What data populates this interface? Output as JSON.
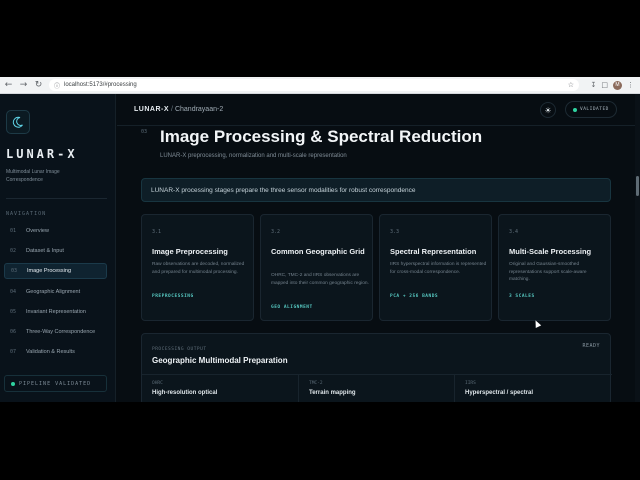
{
  "browser": {
    "url": "localhost:5173/#processing",
    "profile_initial": "M"
  },
  "sidebar": {
    "brand": "LUNAR-X",
    "subtitle": "Multimodal Lunar Image Correspondence",
    "nav_title": "NAVIGATION",
    "items": [
      {
        "num": "01",
        "label": "Overview"
      },
      {
        "num": "02",
        "label": "Dataset & Input"
      },
      {
        "num": "03",
        "label": "Image Processing"
      },
      {
        "num": "04",
        "label": "Geographic Alignment"
      },
      {
        "num": "05",
        "label": "Invariant Representation"
      },
      {
        "num": "06",
        "label": "Three-Way Correspondence"
      },
      {
        "num": "07",
        "label": "Validation & Results"
      }
    ],
    "active_index": 2,
    "status": "PIPELINE VALIDATED"
  },
  "topbar": {
    "app": "LUNAR-X",
    "separator": "/",
    "page": "Chandrayaan-2",
    "validated": "VALIDATED"
  },
  "section": {
    "num": "03",
    "title": "Image Processing & Spectral Reduction",
    "subtitle": "LUNAR-X preprocessing, normalization and multi-scale representation",
    "banner": "LUNAR-X processing stages prepare the three sensor modalities for robust correspondence"
  },
  "cards": [
    {
      "num": "3.1",
      "title": "Image Preprocessing",
      "desc": "Raw observations are decoded, normalized and prepared for multimodal processing.",
      "tag": "PREPROCESSING"
    },
    {
      "num": "3.2",
      "title": "Common Geographic Grid",
      "desc": "OHRC, TMC-2 and IIRS observations are mapped into their common geographic region.",
      "tag": "GEO ALIGNMENT"
    },
    {
      "num": "3.3",
      "title": "Spectral Representation",
      "desc": "IIRS hyperspectral information is represented for cross-modal correspondence.",
      "tag": "PCA + 256 BANDS"
    },
    {
      "num": "3.4",
      "title": "Multi-Scale Processing",
      "desc": "Original and Gaussian-smoothed representations support scale-aware matching.",
      "tag": "3 SCALES"
    }
  ],
  "panel": {
    "label": "PROCESSING OUTPUT",
    "title": "Geographic Multimodal Preparation",
    "status": "READY",
    "columns": [
      {
        "key": "OHRC",
        "value": "High-resolution optical"
      },
      {
        "key": "TMC-2",
        "value": "Terrain mapping"
      },
      {
        "key": "IIRS",
        "value": "Hyperspectral / spectral"
      }
    ]
  },
  "icons": {
    "logo": "crescent-moon-icon",
    "theme": "sun-icon"
  },
  "colors": {
    "accent": "#2fd3a0",
    "tag": "#56c7c0",
    "background": "#070d12"
  }
}
